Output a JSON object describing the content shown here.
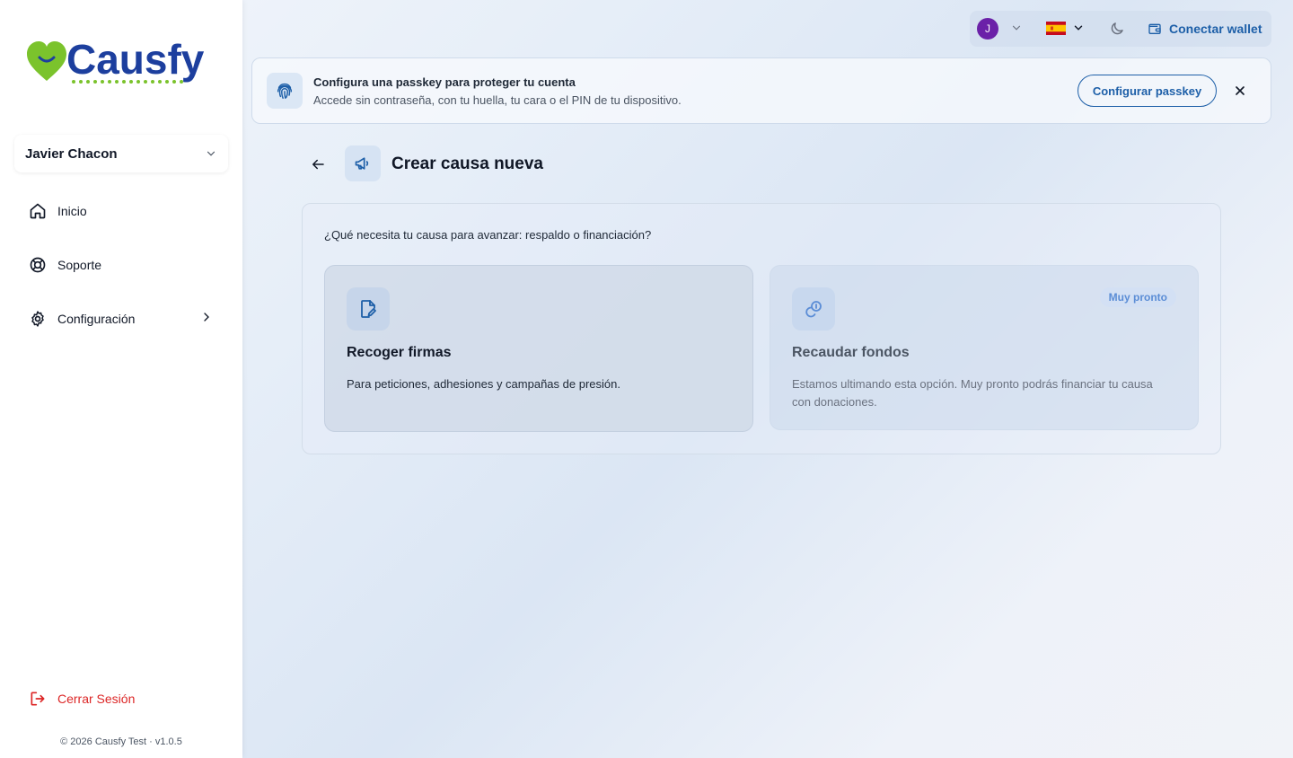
{
  "brand": {
    "name": "Causfy",
    "primary_color": "#1d3f9e",
    "accent_color": "#7bc32c"
  },
  "sidebar": {
    "user_name": "Javier Chacon",
    "items": [
      {
        "label": "Inicio",
        "icon": "home-icon"
      },
      {
        "label": "Soporte",
        "icon": "lifebuoy-icon"
      },
      {
        "label": "Configuración",
        "icon": "gear-icon"
      }
    ],
    "logout_label": "Cerrar Sesión",
    "copyright": "© 2026 Causfy Test · v1.0.5"
  },
  "topbar": {
    "avatar_initial": "J",
    "language_flag": "spain-flag",
    "wallet_label": "Conectar wallet"
  },
  "banner": {
    "title": "Configura una passkey para proteger tu cuenta",
    "subtitle": "Accede sin contraseña, con tu huella, tu cara o el PIN de tu dispositivo.",
    "button_label": "Configurar passkey"
  },
  "page": {
    "title": "Crear causa nueva",
    "question": "¿Qué necesita tu causa para avanzar: respaldo o financiación?",
    "options": [
      {
        "title": "Recoger firmas",
        "description": "Para peticiones, adhesiones y campañas de presión.",
        "icon": "document-pen-icon"
      },
      {
        "title": "Recaudar fondos",
        "description": "Estamos ultimando esta opción. Muy pronto podrás financiar tu causa con donaciones.",
        "badge": "Muy pronto",
        "icon": "coins-icon"
      }
    ]
  }
}
